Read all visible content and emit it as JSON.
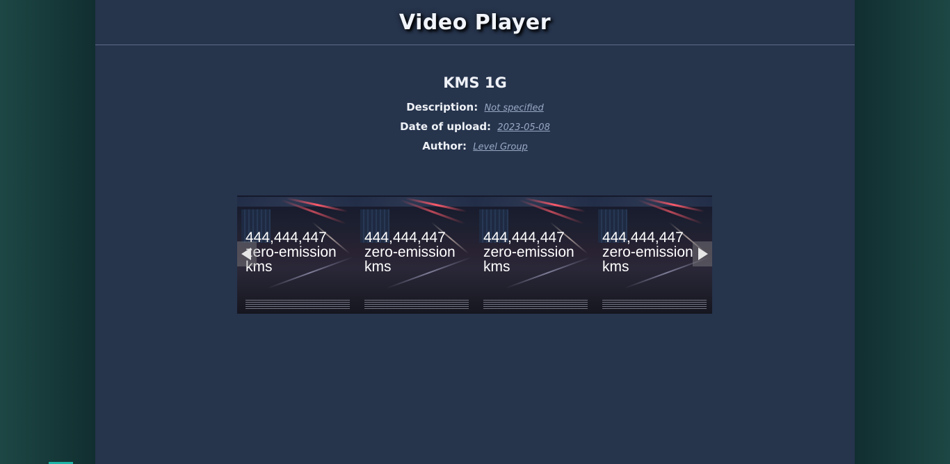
{
  "app": {
    "title": "Video Player"
  },
  "video": {
    "title": "KMS 1G",
    "description_label": "Description:",
    "description_value": "Not specified",
    "date_label": "Date of upload:",
    "date_value": "2023-05-08",
    "author_label": "Author:",
    "author_value": "Level Group"
  },
  "carousel": {
    "frames": [
      {
        "line1": "444,444,447",
        "line2": "zero-emission",
        "line3": "kms"
      },
      {
        "line1": "444,444,447",
        "line2": "zero-emission",
        "line3": "kms"
      },
      {
        "line1": "444,444,447",
        "line2": "zero-emission",
        "line3": "kms"
      },
      {
        "line1": "444,444,447",
        "line2": "zero-emission",
        "line3": "kms"
      }
    ],
    "prev_icon": "chevron-left-icon",
    "next_icon": "chevron-right-icon"
  },
  "colors": {
    "panel": "#26344c",
    "background": "#112e30",
    "link": "#9aaac4",
    "text": "#eef1f6"
  }
}
